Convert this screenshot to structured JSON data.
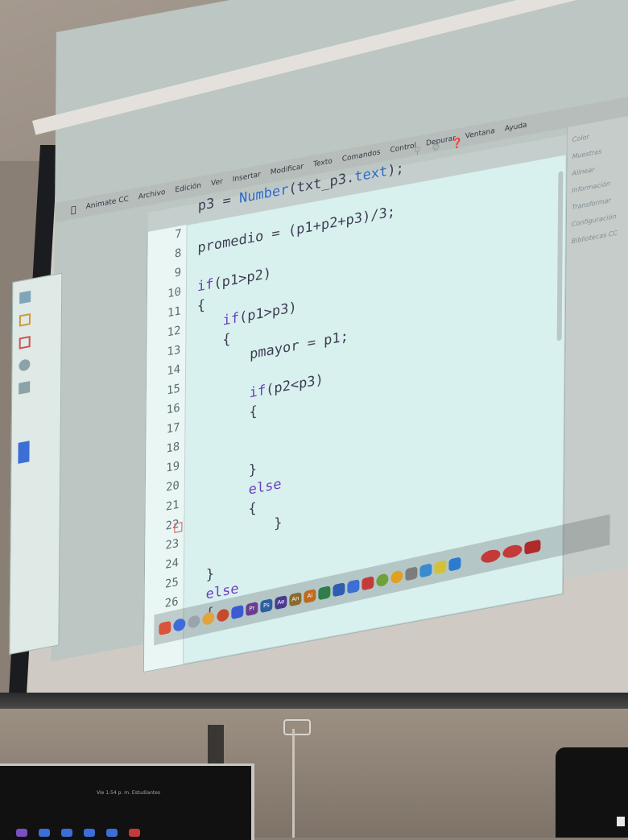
{
  "app": {
    "name": "Animate CC",
    "menu": [
      "Archivo",
      "Edición",
      "Ver",
      "Insertar",
      "Modificar",
      "Texto",
      "Comandos",
      "Control",
      "Depurar",
      "Ventana",
      "Ayuda"
    ]
  },
  "right_panel": [
    "Color",
    "Muestras",
    "Alinear",
    "Información",
    "Transformar",
    "Configuración",
    "Bibliotecas CC"
  ],
  "editor": {
    "line_numbers": [
      "7",
      "8",
      "9",
      "10",
      "11",
      "12",
      "13",
      "14",
      "15",
      "16",
      "17",
      "18",
      "19",
      "20",
      "21",
      "22",
      "23",
      "24",
      "25",
      "26"
    ],
    "lines": {
      "l6": {
        "plain": "p3 = ",
        "fn": "Number",
        "rest": "(txt_p3.",
        "kw": "text",
        "end": ");"
      },
      "l8": "promedio = (p1+p2+p3)/3;",
      "l10_kw": "if",
      "l10_rest": "(p1>p2)",
      "l11": "{",
      "l12_kw": "if",
      "l12_rest": "(p1>p3)",
      "l13": "{",
      "l14": "pmayor = p1;",
      "l15_kw": "if",
      "l15_rest": "(p2<p3)",
      "l16": "{",
      "l19": "}",
      "l20_kw": "else",
      "l21": "{",
      "l22": "}",
      "l24": "}",
      "l25_kw": "else",
      "l26": "{"
    }
  },
  "laptop": {
    "menubar_text": "Vie 1:54 p. m.   Estudiantes"
  },
  "colors": {
    "editor_bg": "#d9f1ee",
    "keyword": "#6b3fbf",
    "function": "#2f69c8",
    "code_text": "#3e3d55"
  }
}
